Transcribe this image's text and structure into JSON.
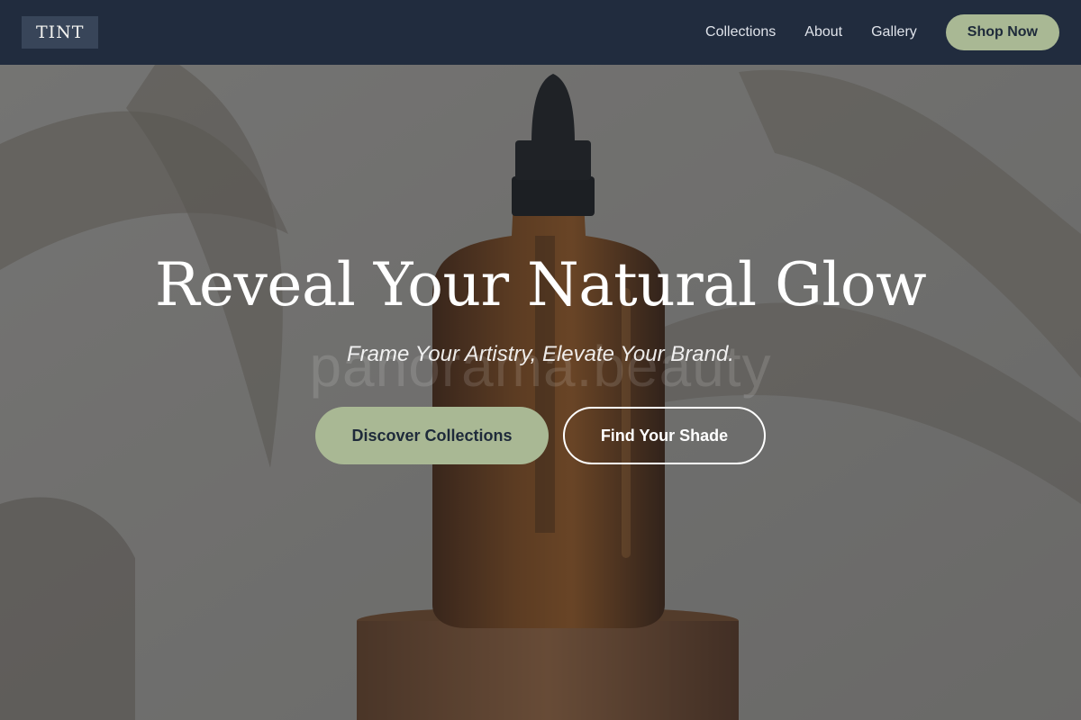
{
  "brand": {
    "logo_text": "TINT"
  },
  "nav": {
    "links": [
      "Collections",
      "About",
      "Gallery"
    ],
    "cta_label": "Shop Now"
  },
  "hero": {
    "headline": "Reveal Your Natural Glow",
    "tagline": "Frame Your Artistry, Elevate Your Brand.",
    "primary_button": "Discover Collections",
    "secondary_button": "Find Your Shade",
    "watermark_text": "panorama.beauty",
    "image_subject": "amber-dropper-bottle-on-wooden-stand"
  },
  "colors": {
    "navbar_bg": "#212c3e",
    "logo_bg": "#384559",
    "accent_sage": "#a9b894",
    "text_dark": "#1e2a3a",
    "text_light": "#ffffff"
  }
}
